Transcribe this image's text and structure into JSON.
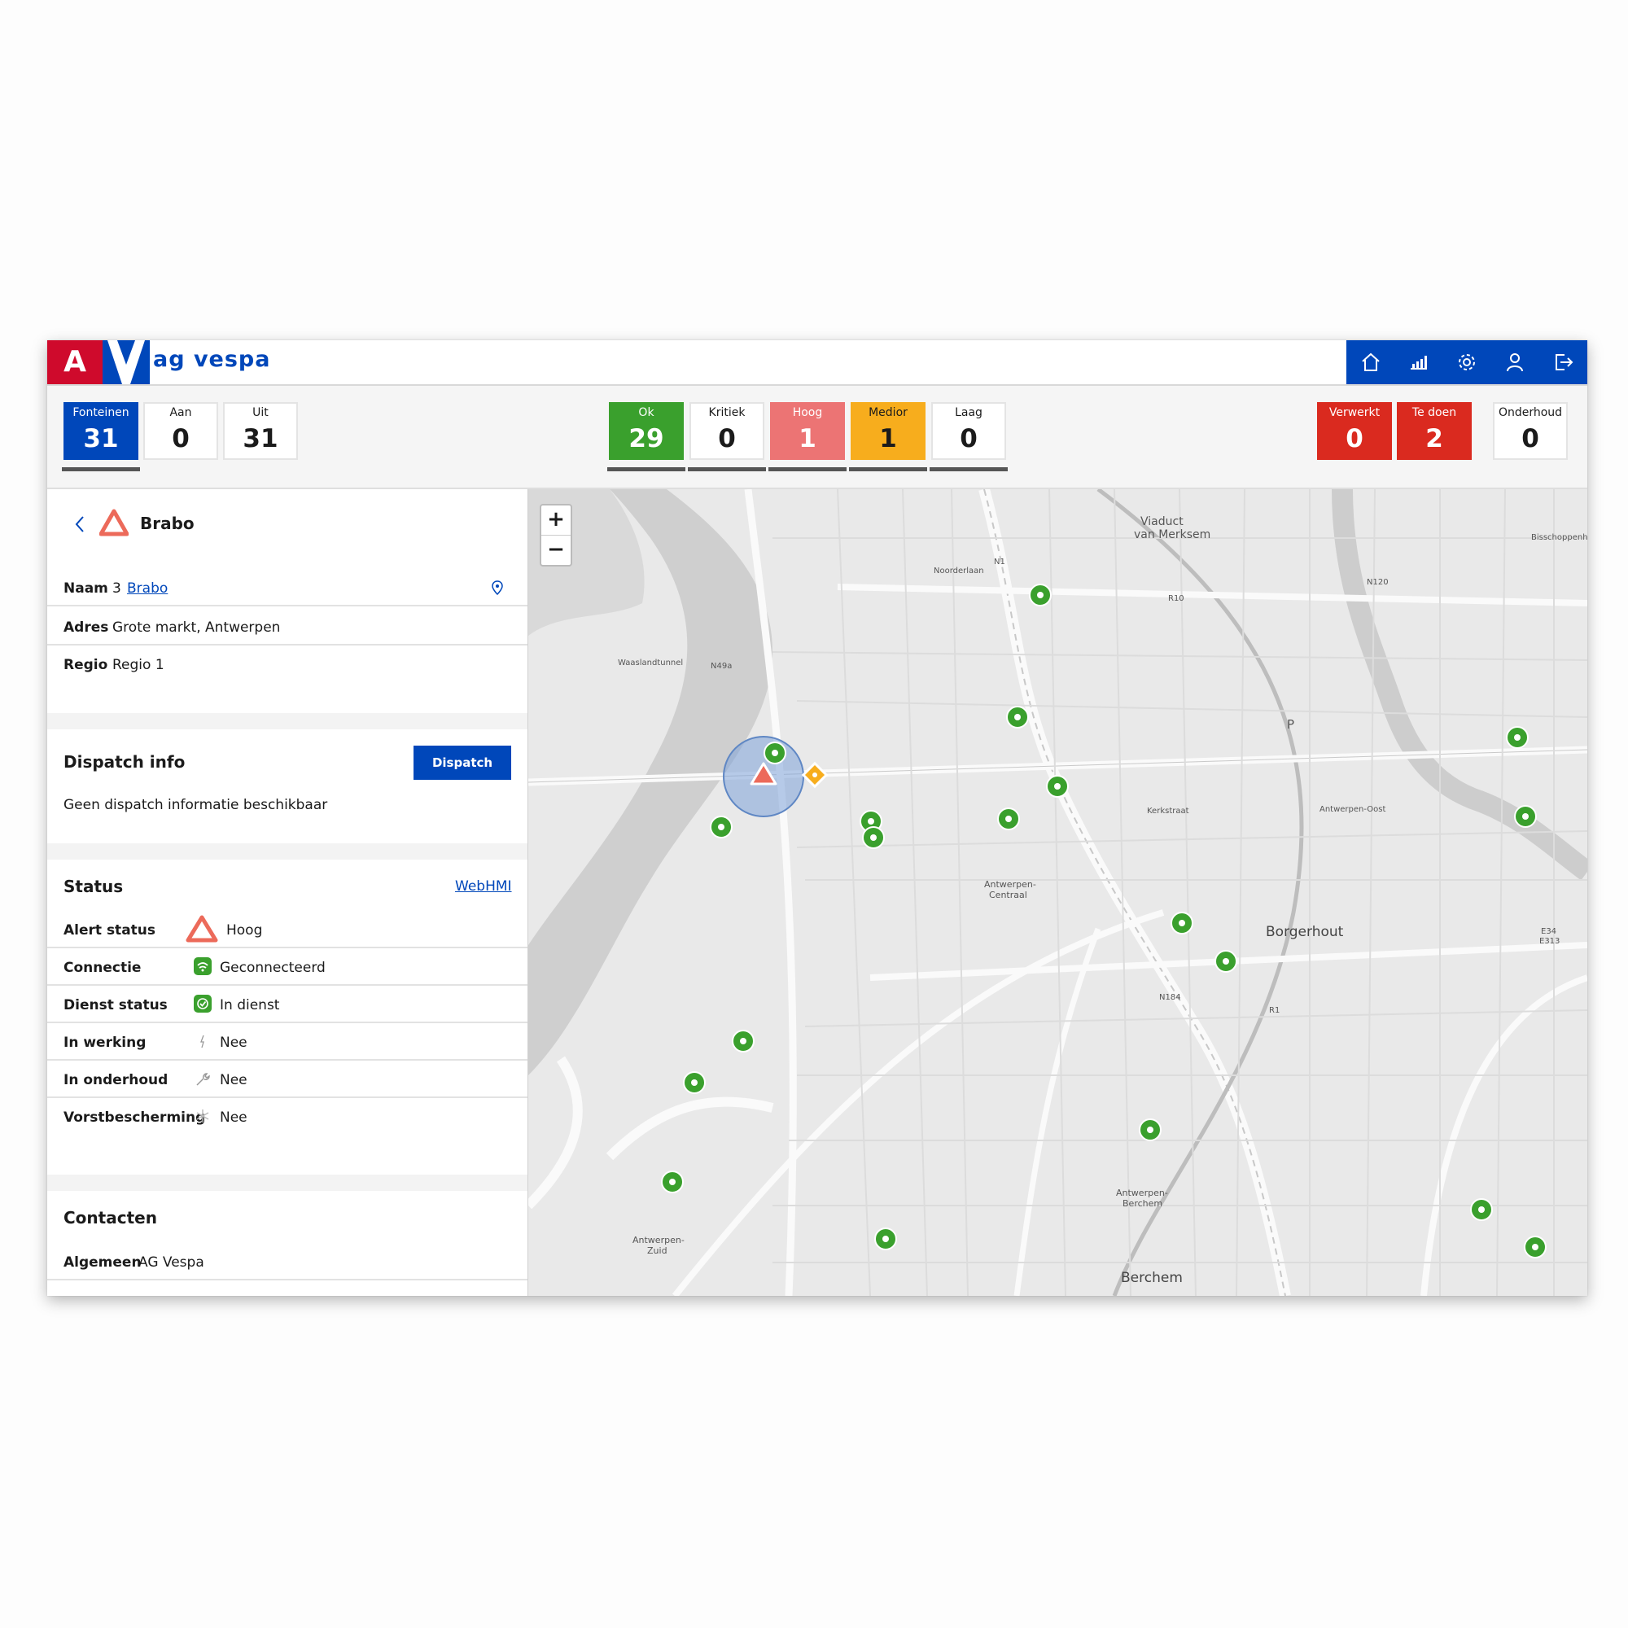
{
  "header": {
    "logo_letter": "A",
    "app_title": "ag vespa",
    "nav_icons": [
      "home-icon",
      "chart-icon",
      "gear-icon",
      "user-icon",
      "logout-icon"
    ]
  },
  "stats": {
    "fonteinen": {
      "label": "Fonteinen",
      "value": "31"
    },
    "aan": {
      "label": "Aan",
      "value": "0"
    },
    "uit": {
      "label": "Uit",
      "value": "31"
    },
    "ok": {
      "label": "Ok",
      "value": "29"
    },
    "kritiek": {
      "label": "Kritiek",
      "value": "0"
    },
    "hoog": {
      "label": "Hoog",
      "value": "1"
    },
    "medior": {
      "label": "Medior",
      "value": "1"
    },
    "laag": {
      "label": "Laag",
      "value": "0"
    },
    "verwerkt": {
      "label": "Verwerkt",
      "value": "0"
    },
    "tedoen": {
      "label": "Te doen",
      "value": "2"
    },
    "onderhoud": {
      "label": "Onderhoud",
      "value": "0"
    }
  },
  "panel": {
    "title": "Brabo",
    "naam_label": "Naam",
    "naam_number": "3",
    "naam_link": "Brabo",
    "adres_label": "Adres",
    "adres_value": "Grote markt, Antwerpen",
    "regio_label": "Regio",
    "regio_value": "Regio 1",
    "dispatch_title": "Dispatch info",
    "dispatch_button": "Dispatch",
    "dispatch_text": "Geen dispatch informatie beschikbaar",
    "status_title": "Status",
    "webhmi_link": "WebHMI",
    "status_rows": [
      {
        "label": "Alert status",
        "value": "Hoog"
      },
      {
        "label": "Connectie",
        "value": "Geconnecteerd"
      },
      {
        "label": "Dienst status",
        "value": "In dienst"
      },
      {
        "label": "In werking",
        "value": "Nee"
      },
      {
        "label": "In onderhoud",
        "value": "Nee"
      },
      {
        "label": "Vorstbescherming",
        "value": "Nee"
      }
    ],
    "contacten_title": "Contacten",
    "algemeen_label": "Algemeen",
    "algemeen_value": "AG Vespa"
  },
  "map": {
    "zoom_in": "+",
    "zoom_out": "−",
    "labels": {
      "viaduct": "Viaduct\nvan Merksem",
      "noorderlaan": "Noorderlaan",
      "n1": "N1",
      "r10": "R10",
      "n120": "N120",
      "waaslandtunnel": "Waaslandtunnel",
      "n49a": "N49a",
      "borgerhout": "Borgerhout",
      "antwerpen_centraal": "Antwerpen-\nCentraal",
      "antwerpen_oost": "Antwerpen-Oost",
      "e34": "E34\nE313",
      "n184": "N184",
      "r1": "R1",
      "antwerpen_berchem": "Antwerpen-\nBerchem",
      "berchem": "Berchem",
      "antwerpen_zuid": "Antwerpen-\nZuid",
      "kerkstraat": "Kerkstraat",
      "bisschoppenhof": "Bisschoppenh",
      "p": "P"
    }
  },
  "colors": {
    "brand_blue": "#0047ba",
    "brand_red": "#cf0a2c",
    "ok_green": "#3aa02d",
    "hoog_salmon": "#ec7474",
    "medior_amber": "#f7ad1d",
    "alert_red": "#da2a1f"
  }
}
